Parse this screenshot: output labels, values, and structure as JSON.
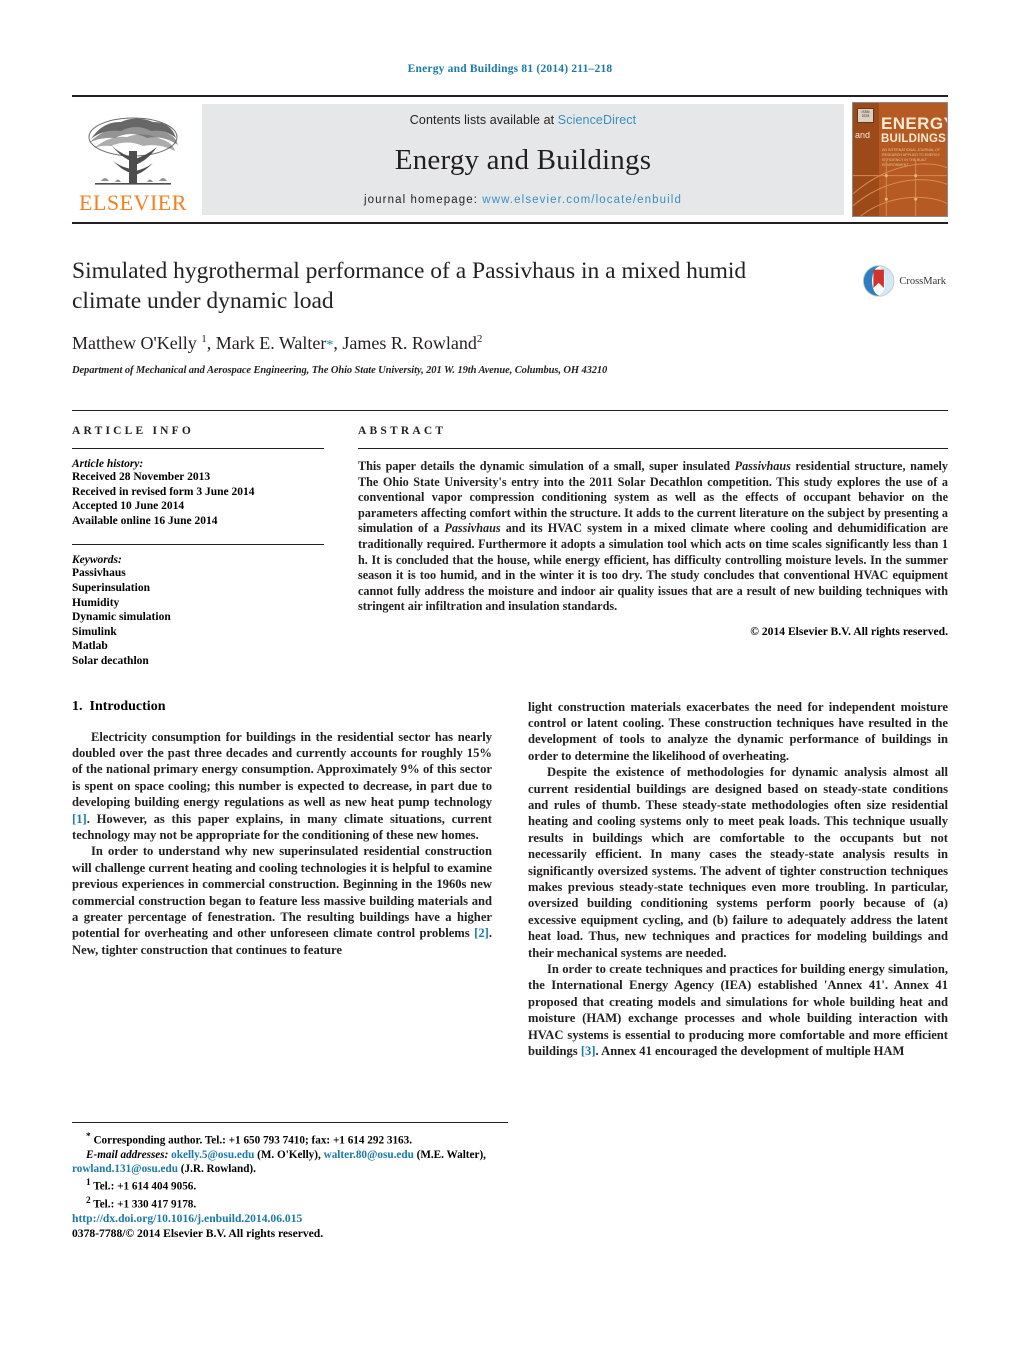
{
  "running_head": "Energy and Buildings 81 (2014) 211–218",
  "header": {
    "publisher": "ELSEVIER",
    "contents_prefix": "Contents lists available at ",
    "contents_link": "ScienceDirect",
    "journal_name": "Energy and Buildings",
    "homepage_prefix": "journal homepage: ",
    "homepage_url": "www.elsevier.com/locate/enbuild",
    "cover": {
      "and": "and",
      "energy": "ENERGY",
      "buildings": "BUILDINGS",
      "sub": "AN INTERNATIONAL JOURNAL OF RESEARCH APPLIED TO ENERGY EFFICIENCY IN THE BUILT ENVIRONMENT"
    }
  },
  "article": {
    "title": "Simulated hygrothermal performance of a Passivhaus in a mixed humid climate under dynamic load",
    "crossmark_label": "CrossMark",
    "authors_html": "Matthew O'Kelly <sup>1</sup>, Mark E. Walter<span class=\"star\">*</span>, James R. Rowland<sup>2</sup>",
    "affiliation": "Department of Mechanical and Aerospace Engineering, The Ohio State University, 201 W. 19th Avenue, Columbus, OH 43210"
  },
  "info": {
    "heading": "ARTICLE INFO",
    "history_title": "Article history:",
    "history": [
      "Received 28 November 2013",
      "Received in revised form 3 June 2014",
      "Accepted 10 June 2014",
      "Available online 16 June 2014"
    ],
    "keywords_title": "Keywords:",
    "keywords": [
      "Passivhaus",
      "Superinsulation",
      "Humidity",
      "Dynamic simulation",
      "Simulink",
      "Matlab",
      "Solar decathlon"
    ]
  },
  "abstract": {
    "heading": "ABSTRACT",
    "text_html": "This paper details the dynamic simulation of a small, super insulated <i>Passivhaus</i> residential structure, namely The Ohio State University's entry into the 2011 Solar Decathlon competition. This study explores the use of a conventional vapor compression conditioning system as well as the effects of occupant behavior on the parameters affecting comfort within the structure. It adds to the current literature on the subject by presenting a simulation of a <i>Passivhaus</i> and its HVAC system in a mixed climate where cooling and dehumidification are traditionally required. Furthermore it adopts a simulation tool which acts on time scales significantly less than 1 h. It is concluded that the house, while energy efficient, has difficulty controlling moisture levels. In the summer season it is too humid, and in the winter it is too dry. The study concludes that conventional HVAC equipment cannot fully address the moisture and indoor air quality issues that are a result of new building techniques with stringent air infiltration and insulation standards.",
    "copyright": "© 2014 Elsevier B.V. All rights reserved."
  },
  "body": {
    "section_number": "1.",
    "section_title": "Introduction",
    "left_paragraphs_html": [
      "Electricity consumption for buildings in the residential sector has nearly doubled over the past three decades and currently accounts for roughly 15% of the national primary energy consumption. Approximately 9% of this sector is spent on space cooling; this number is expected to decrease, in part due to developing building energy regulations as well as new heat pump technology <span class=\"ref\">[1]</span>. However, as this paper explains, in many climate situations, current technology may not be appropriate for the conditioning of these new homes.",
      "In order to understand why new superinsulated residential construction will challenge current heating and cooling technologies it is helpful to examine previous experiences in commercial construction. Beginning in the 1960s new commercial construction began to feature less massive building materials and a greater percentage of fenestration. The resulting buildings have a higher potential for overheating and other unforeseen climate control problems <span class=\"ref\">[2]</span>. New, tighter construction that continues to feature"
    ],
    "right_paragraphs_html": [
      "light construction materials exacerbates the need for independent moisture control or latent cooling. These construction techniques have resulted in the development of tools to analyze the dynamic performance of buildings in order to determine the likelihood of overheating.",
      "Despite the existence of methodologies for dynamic analysis almost all current residential buildings are designed based on steady-state conditions and rules of thumb. These steady-state methodologies often size residential heating and cooling systems only to meet peak loads. This technique usually results in buildings which are comfortable to the occupants but not necessarily efficient. In many cases the steady-state analysis results in significantly oversized systems. The advent of tighter construction techniques makes previous steady-state techniques even more troubling. In particular, oversized building conditioning systems perform poorly because of (a) excessive equipment cycling, and (b) failure to adequately address the latent heat load. Thus, new techniques and practices for modeling buildings and their mechanical systems are needed.",
      "In order to create techniques and practices for building energy simulation, the International Energy Agency (IEA) established 'Annex 41'. Annex 41 proposed that creating models and simulations for whole building heat and moisture (HAM) exchange processes and whole building interaction with HVAC systems is essential to producing more comfortable and more efficient buildings <span class=\"ref\">[3]</span>. Annex 41 encouraged the development of multiple HAM"
    ]
  },
  "footnotes": {
    "corresponding_html": "<sup>*</sup> Corresponding author. Tel.: +1 650 793 7410; fax: +1 614 292 3163.",
    "emails_html": "<i>E-mail addresses:</i> <span class=\"lnk\">okelly.5@osu.edu</span> (M. O'Kelly), <span class=\"lnk\">walter.80@osu.edu</span> (M.E. Walter), <span class=\"lnk\">rowland.131@osu.edu</span> (J.R. Rowland).",
    "tel1_html": "<sup>1</sup> Tel.: +1 614 404 9056.",
    "tel2_html": "<sup>2</sup> Tel.: +1 330 417 9178."
  },
  "bottom": {
    "doi": "http://dx.doi.org/10.1016/j.enbuild.2014.06.015",
    "issn_line": "0378-7788/© 2014 Elsevier B.V. All rights reserved."
  },
  "colors": {
    "link_blue": "#1a7aa8",
    "science_direct_blue": "#3a8fc0",
    "elsevier_orange": "#f08221",
    "cover_orange": "#b45a22",
    "band_gray": "#e6e7e8"
  }
}
